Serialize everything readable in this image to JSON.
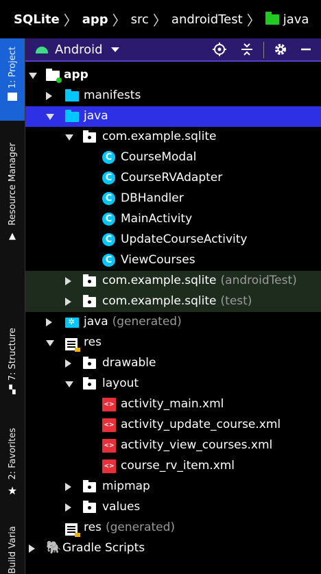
{
  "breadcrumb": [
    "SQLite",
    "app",
    "src",
    "androidTest",
    "java"
  ],
  "sidebar": {
    "tabs": [
      "1: Project",
      "Resource Manager",
      "7: Structure",
      "2: Favorites",
      "Build Variants"
    ]
  },
  "toolbar": {
    "view_label": "Android"
  },
  "tree": [
    {
      "label": "app",
      "extra": "",
      "icon": "app-module-icon",
      "arrow": "down",
      "level": 0,
      "bold": true
    },
    {
      "label": "manifests",
      "extra": "",
      "icon": "folder-icon",
      "arrow": "right",
      "level": 1
    },
    {
      "label": "java",
      "extra": "",
      "icon": "folder-icon",
      "arrow": "down",
      "level": 1,
      "selected": true
    },
    {
      "label": "com.example.sqlite",
      "extra": "",
      "icon": "package-icon",
      "arrow": "down",
      "level": 2
    },
    {
      "label": "CourseModal",
      "extra": "",
      "icon": "class-icon",
      "arrow": "",
      "level": 3
    },
    {
      "label": "CourseRVAdapter",
      "extra": "",
      "icon": "class-icon",
      "arrow": "",
      "level": 3
    },
    {
      "label": "DBHandler",
      "extra": "",
      "icon": "class-icon",
      "arrow": "",
      "level": 3
    },
    {
      "label": "MainActivity",
      "extra": "",
      "icon": "class-icon",
      "arrow": "",
      "level": 3
    },
    {
      "label": "UpdateCourseActivity",
      "extra": "",
      "icon": "class-icon",
      "arrow": "",
      "level": 3
    },
    {
      "label": "ViewCourses",
      "extra": "",
      "icon": "class-icon",
      "arrow": "",
      "level": 3
    },
    {
      "label": "com.example.sqlite",
      "extra": "(androidTest)",
      "icon": "package-icon",
      "arrow": "right",
      "level": 2,
      "test": true
    },
    {
      "label": "com.example.sqlite",
      "extra": "(test)",
      "icon": "package-icon",
      "arrow": "right",
      "level": 2,
      "test": true
    },
    {
      "label": "java",
      "extra": "(generated)",
      "icon": "generated-folder-icon",
      "arrow": "right",
      "level": 1
    },
    {
      "label": "res",
      "extra": "",
      "icon": "res-folder-icon",
      "arrow": "down",
      "level": 1
    },
    {
      "label": "drawable",
      "extra": "",
      "icon": "package-icon",
      "arrow": "right",
      "level": 2
    },
    {
      "label": "layout",
      "extra": "",
      "icon": "package-icon",
      "arrow": "down",
      "level": 2
    },
    {
      "label": "activity_main.xml",
      "extra": "",
      "icon": "xml-file-icon",
      "arrow": "",
      "level": 3
    },
    {
      "label": "activity_update_course.xml",
      "extra": "",
      "icon": "xml-file-icon",
      "arrow": "",
      "level": 3
    },
    {
      "label": "activity_view_courses.xml",
      "extra": "",
      "icon": "xml-file-icon",
      "arrow": "",
      "level": 3
    },
    {
      "label": "course_rv_item.xml",
      "extra": "",
      "icon": "xml-file-icon",
      "arrow": "",
      "level": 3
    },
    {
      "label": "mipmap",
      "extra": "",
      "icon": "package-icon",
      "arrow": "right",
      "level": 2
    },
    {
      "label": "values",
      "extra": "",
      "icon": "package-icon",
      "arrow": "right",
      "level": 2
    },
    {
      "label": "res",
      "extra": "(generated)",
      "icon": "res-folder-icon",
      "arrow": "",
      "level": 1
    },
    {
      "label": "Gradle Scripts",
      "extra": "",
      "icon": "gradle-icon",
      "arrow": "right",
      "level": 0
    }
  ],
  "colors": {
    "selected": "#2d30e4",
    "test_bg": "#1e2c1e",
    "toolbar_bg": "#2c1a6e",
    "accent_tab": "#1a63d6"
  }
}
